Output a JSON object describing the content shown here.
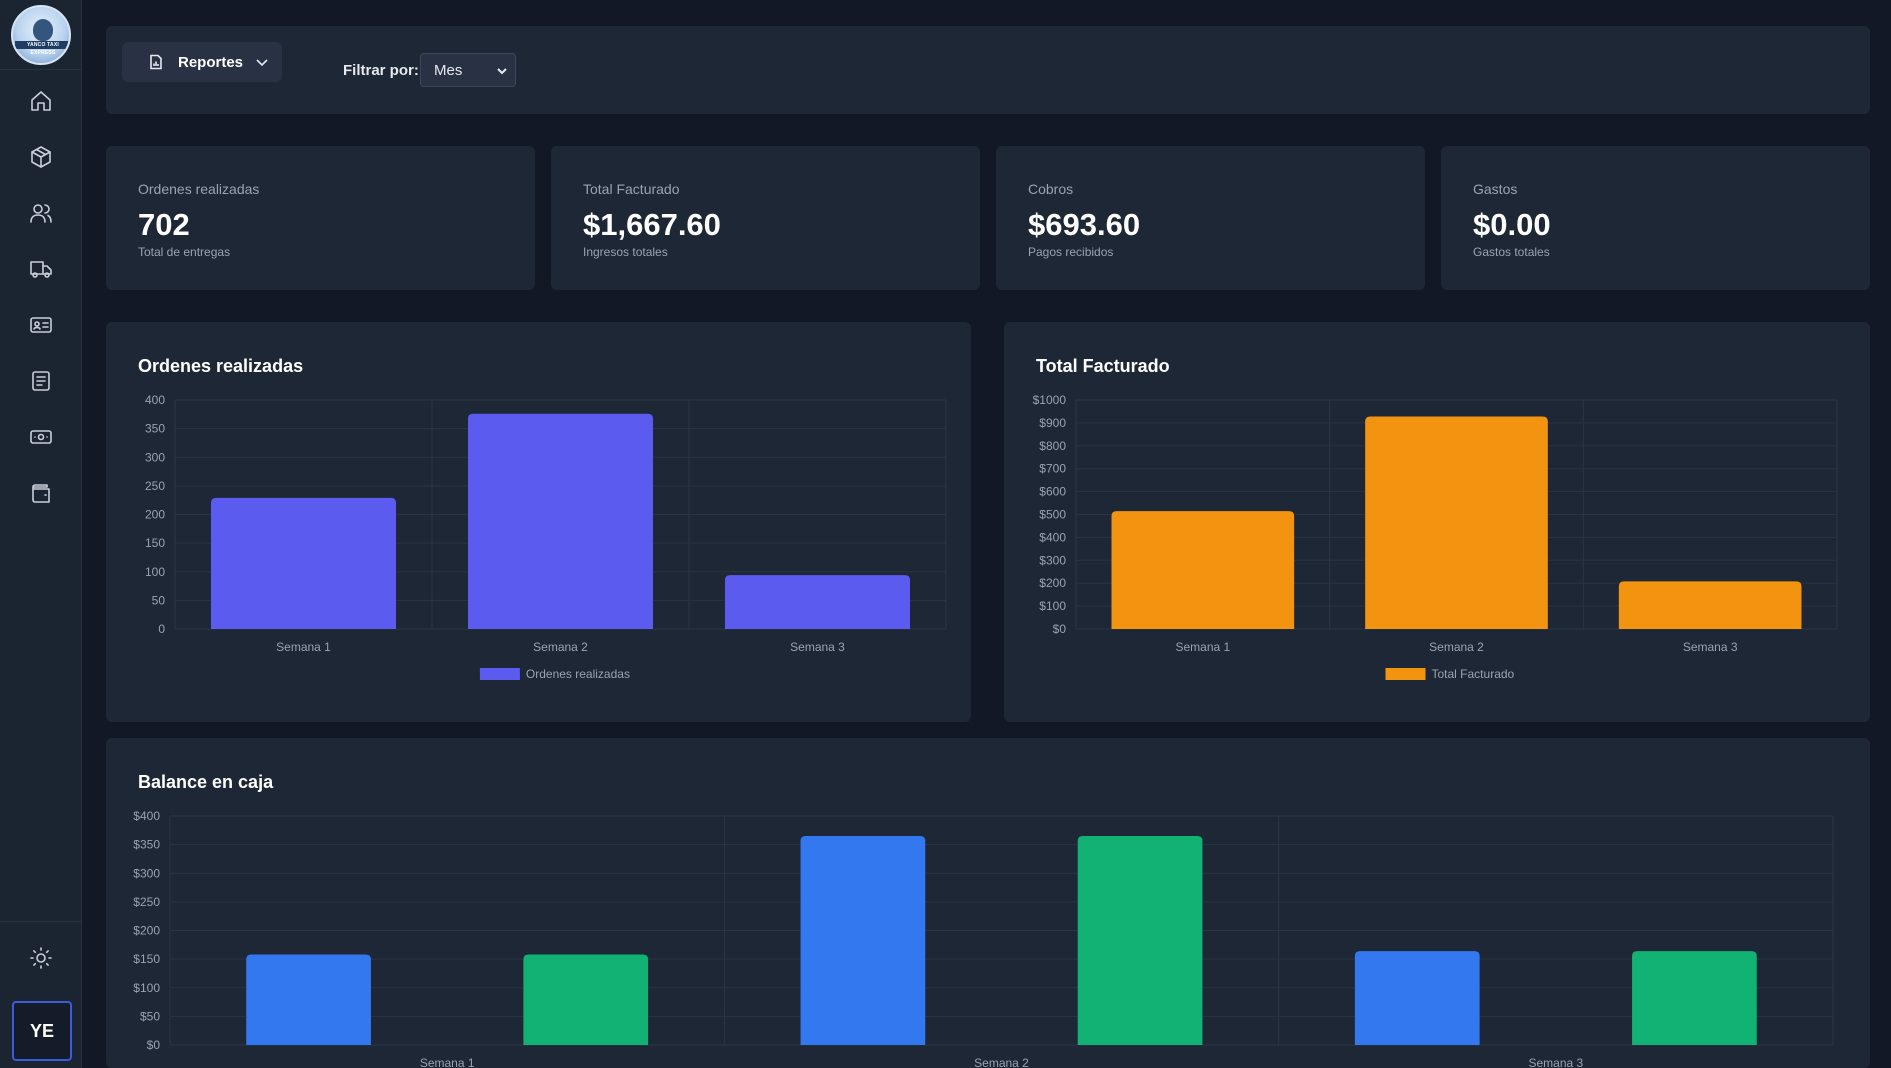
{
  "sidebar": {
    "logo_text": "YANCO TAXI EXPRESS",
    "items": [
      {
        "icon": "home-icon"
      },
      {
        "icon": "package-icon"
      },
      {
        "icon": "users-icon"
      },
      {
        "icon": "truck-icon"
      },
      {
        "icon": "id-card-icon"
      },
      {
        "icon": "document-list-icon"
      },
      {
        "icon": "money-icon"
      },
      {
        "icon": "wallet-icon"
      }
    ],
    "theme_icon": "sun-icon",
    "avatar_initials": "YE"
  },
  "toolbar": {
    "reports_label": "Reportes",
    "filter_label": "Filtrar por:",
    "filter_value": "Mes"
  },
  "stats": [
    {
      "label": "Ordenes realizadas",
      "value": "702",
      "sub": "Total de entregas"
    },
    {
      "label": "Total Facturado",
      "value": "$1,667.60",
      "sub": "Ingresos totales"
    },
    {
      "label": "Cobros",
      "value": "$693.60",
      "sub": "Pagos recibidos"
    },
    {
      "label": "Gastos",
      "value": "$0.00",
      "sub": "Gastos totales"
    }
  ],
  "colors": {
    "orders": "#5b5bef",
    "billing": "#f39410",
    "balance_a": "#3478f0",
    "balance_b": "#12b174"
  },
  "chart_data": [
    {
      "type": "bar",
      "title": "Ordenes realizadas",
      "categories": [
        "Semana 1",
        "Semana 2",
        "Semana 3"
      ],
      "series": [
        {
          "name": "Ordenes realizadas",
          "values": [
            229,
            376,
            94
          ]
        }
      ],
      "ylim": [
        0,
        400
      ],
      "yticks": [
        0,
        50,
        100,
        150,
        200,
        250,
        300,
        350,
        400
      ],
      "ytick_labels": [
        "0",
        "50",
        "100",
        "150",
        "200",
        "250",
        "300",
        "350",
        "400"
      ],
      "grid": true,
      "legend": "bottom"
    },
    {
      "type": "bar",
      "title": "Total Facturado",
      "categories": [
        "Semana 1",
        "Semana 2",
        "Semana 3"
      ],
      "series": [
        {
          "name": "Total Facturado",
          "values": [
            515,
            928,
            208
          ]
        }
      ],
      "ylim": [
        0,
        1000
      ],
      "yticks": [
        0,
        100,
        200,
        300,
        400,
        500,
        600,
        700,
        800,
        900,
        1000
      ],
      "ytick_labels": [
        "$0",
        "$100",
        "$200",
        "$300",
        "$400",
        "$500",
        "$600",
        "$700",
        "$800",
        "$900",
        "$1000"
      ],
      "grid": true,
      "legend": "bottom"
    },
    {
      "type": "bar",
      "title": "Balance en caja",
      "categories": [
        "Semana 1",
        "Semana 2",
        "Semana 3"
      ],
      "series": [
        {
          "values": [
            158,
            365,
            164
          ]
        },
        {
          "values": [
            158,
            365,
            164
          ]
        }
      ],
      "ylim": [
        0,
        400
      ],
      "yticks": [
        0,
        50,
        100,
        150,
        200,
        250,
        300,
        350,
        400
      ],
      "ytick_labels": [
        "$0",
        "$50",
        "$100",
        "$150",
        "$200",
        "$250",
        "$300",
        "$350",
        "$400"
      ],
      "grid": true
    }
  ]
}
